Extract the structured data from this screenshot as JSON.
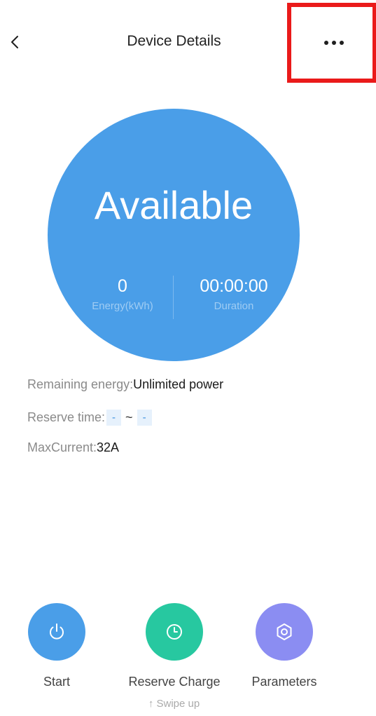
{
  "header": {
    "title": "Device Details",
    "back_icon": "chevron-left-icon",
    "more_icon": "more-horizontal-icon",
    "highlight_color": "#ea1a1a"
  },
  "status": {
    "label": "Available",
    "color": "#4a9ee8",
    "energy_value": "0",
    "energy_label": "Energy(kWh)",
    "duration_value": "00:00:00",
    "duration_label": "Duration"
  },
  "info": {
    "remaining_energy_label": "Remaining energy:",
    "remaining_energy_value": "Unlimited power",
    "reserve_time_label": "Reserve time:",
    "reserve_time_start": "-",
    "reserve_time_separator": "~",
    "reserve_time_end": "-",
    "max_current_label": "MaxCurrent:",
    "max_current_value": "32A"
  },
  "actions": {
    "start": {
      "label": "Start",
      "icon": "power-icon",
      "color": "#4a9ee8"
    },
    "reserve": {
      "label": "Reserve Charge",
      "icon": "clock-icon",
      "color": "#27c8a0"
    },
    "parameters": {
      "label": "Parameters",
      "icon": "gear-icon",
      "color": "#8b8df2"
    }
  },
  "swipe_hint": "↑ Swipe up"
}
